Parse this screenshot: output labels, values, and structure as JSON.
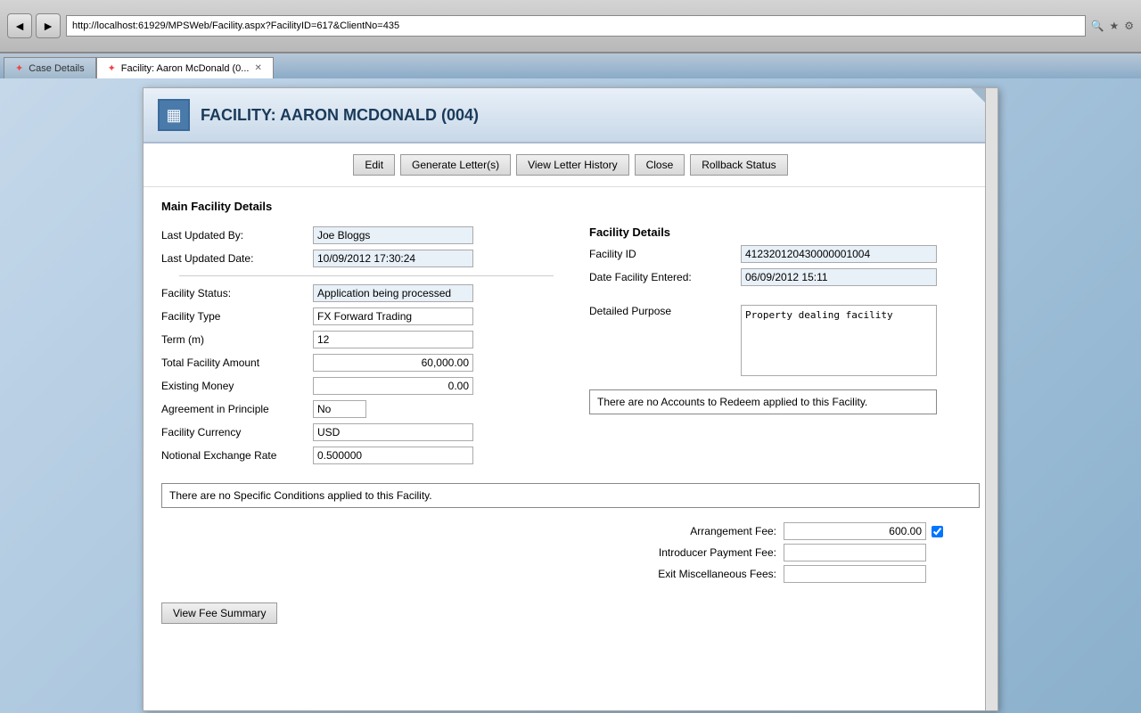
{
  "browser": {
    "url": "http://localhost:61929/MPSWeb/Facility.aspx?FacilityID=617&ClientNo=435",
    "tab_inactive_label": "Case Details",
    "tab_active_label": "Facility: Aaron McDonald (0...",
    "back_icon": "◄",
    "forward_icon": "►"
  },
  "header": {
    "icon": "▦",
    "title": "FACILITY: AARON MCDONALD (004)"
  },
  "toolbar": {
    "edit_label": "Edit",
    "generate_label": "Generate Letter(s)",
    "view_history_label": "View Letter History",
    "close_label": "Close",
    "rollback_label": "Rollback Status"
  },
  "section": {
    "main_title": "Main Facility Details"
  },
  "left_panel": {
    "last_updated_by_label": "Last Updated By:",
    "last_updated_by_value": "Joe Bloggs",
    "last_updated_date_label": "Last Updated Date:",
    "last_updated_date_value": "10/09/2012 17:30:24",
    "facility_status_label": "Facility Status:",
    "facility_status_value": "Application being processed",
    "facility_type_label": "Facility Type",
    "facility_type_value": "FX Forward Trading",
    "term_label": "Term (m)",
    "term_value": "12",
    "total_facility_label": "Total Facility Amount",
    "total_facility_value": "60,000.00",
    "existing_money_label": "Existing Money",
    "existing_money_value": "0.00",
    "agreement_label": "Agreement in Principle",
    "agreement_value": "No",
    "facility_currency_label": "Facility Currency",
    "facility_currency_value": "USD",
    "notional_rate_label": "Notional Exchange Rate",
    "notional_rate_value": "0.500000"
  },
  "right_panel": {
    "facility_details_heading": "Facility Details",
    "facility_id_label": "Facility ID",
    "facility_id_value": "412320120430000001004",
    "date_entered_label": "Date Facility Entered:",
    "date_entered_value": "06/09/2012 15:11",
    "detailed_purpose_label": "Detailed Purpose",
    "detailed_purpose_value": "Property dealing facility",
    "no_accounts_message": "There are no Accounts to Redeem applied to this Facility."
  },
  "no_specific_message": "There are no Specific Conditions applied to this Facility.",
  "fees": {
    "arrangement_label": "Arrangement Fee:",
    "arrangement_value": "600.00",
    "introducer_label": "Introducer Payment Fee:",
    "introducer_value": "",
    "exit_label": "Exit Miscellaneous Fees:",
    "exit_value": ""
  },
  "bottom": {
    "view_fee_label": "View Fee Summary"
  }
}
